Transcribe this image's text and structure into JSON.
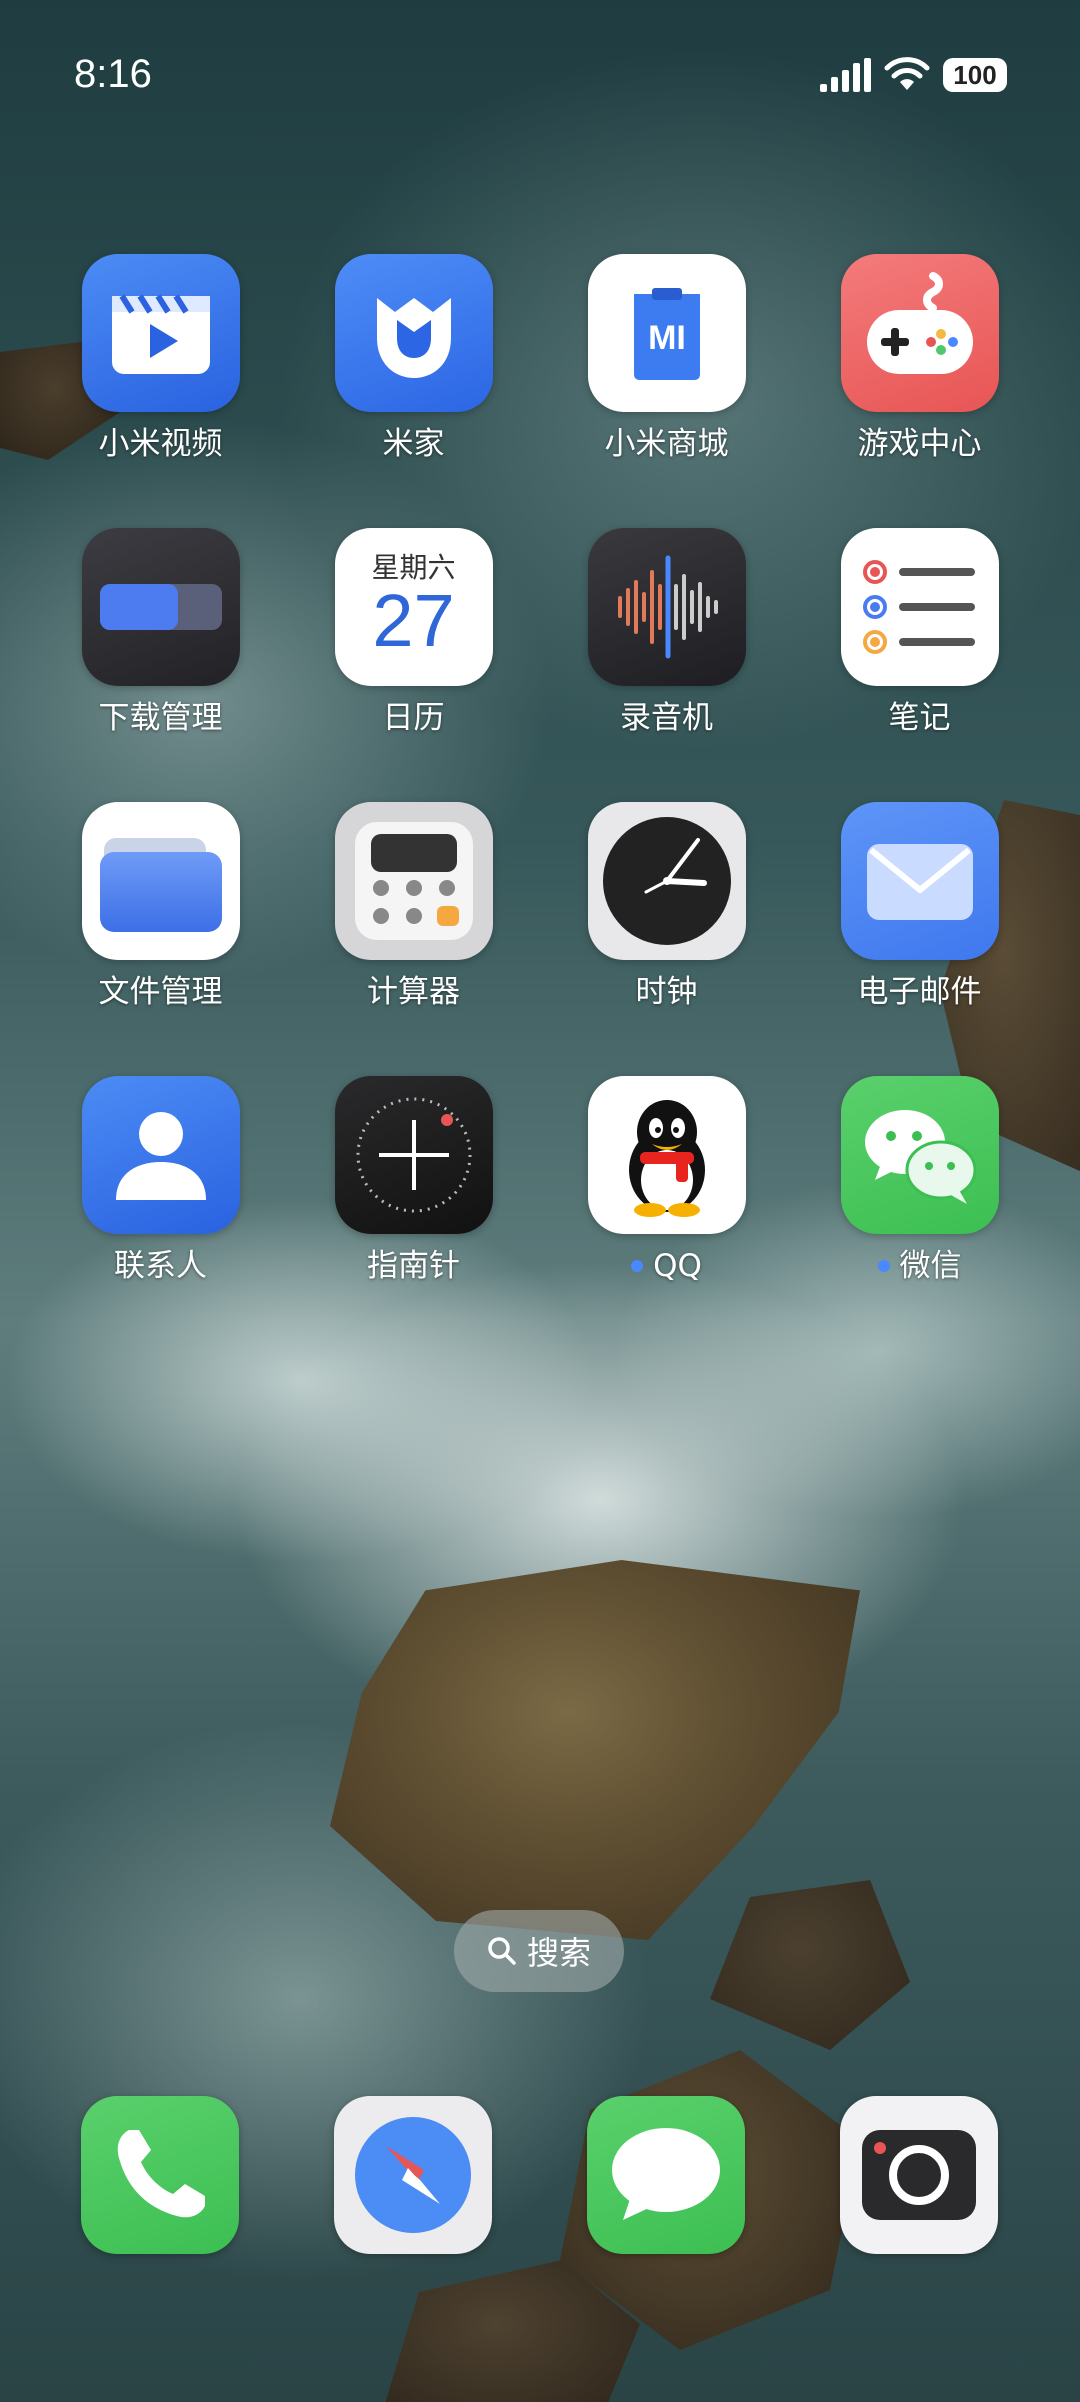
{
  "status_bar": {
    "time": "8:16",
    "battery": "100",
    "signal_icon": "signal-icon",
    "wifi_icon": "wifi-icon"
  },
  "apps": [
    {
      "label": "小米视频",
      "icon": "video-icon",
      "notification_dot": false
    },
    {
      "label": "米家",
      "icon": "mijia-icon",
      "notification_dot": false
    },
    {
      "label": "小米商城",
      "icon": "mi-store-icon",
      "notification_dot": false
    },
    {
      "label": "游戏中心",
      "icon": "gamepad-icon",
      "notification_dot": false
    },
    {
      "label": "下载管理",
      "icon": "download-manager-icon",
      "notification_dot": false
    },
    {
      "label": "日历",
      "icon": "calendar-icon",
      "notification_dot": false,
      "calendar_weekday": "星期六",
      "calendar_day": "27"
    },
    {
      "label": "录音机",
      "icon": "recorder-icon",
      "notification_dot": false
    },
    {
      "label": "笔记",
      "icon": "notes-icon",
      "notification_dot": false
    },
    {
      "label": "文件管理",
      "icon": "folder-icon",
      "notification_dot": false
    },
    {
      "label": "计算器",
      "icon": "calculator-icon",
      "notification_dot": false
    },
    {
      "label": "时钟",
      "icon": "clock-icon",
      "notification_dot": false
    },
    {
      "label": "电子邮件",
      "icon": "mail-icon",
      "notification_dot": false
    },
    {
      "label": "联系人",
      "icon": "contacts-icon",
      "notification_dot": false
    },
    {
      "label": "指南针",
      "icon": "compass-icon",
      "notification_dot": false
    },
    {
      "label": "QQ",
      "icon": "qq-penguin-icon",
      "notification_dot": true
    },
    {
      "label": "微信",
      "icon": "wechat-icon",
      "notification_dot": true
    }
  ],
  "search": {
    "label": "搜索",
    "icon": "search-icon"
  },
  "dock": [
    {
      "icon": "phone-icon"
    },
    {
      "icon": "browser-compass-icon"
    },
    {
      "icon": "messages-icon"
    },
    {
      "icon": "camera-icon"
    }
  ],
  "colors": {
    "notification_dot": "#4a88ff",
    "label_text": "#ffffff"
  }
}
